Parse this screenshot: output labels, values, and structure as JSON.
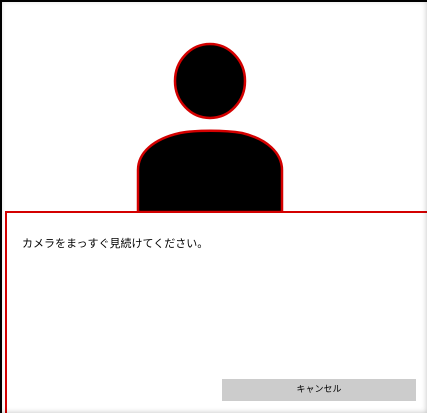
{
  "dialog": {
    "message": "カメラをまっすぐ見続けてください。",
    "cancel_label": "キャンセル"
  },
  "colors": {
    "highlight": "#d40000",
    "silhouette": "#000000",
    "button_bg": "#cccccc"
  },
  "icons": {
    "avatar": "person-silhouette-icon"
  }
}
